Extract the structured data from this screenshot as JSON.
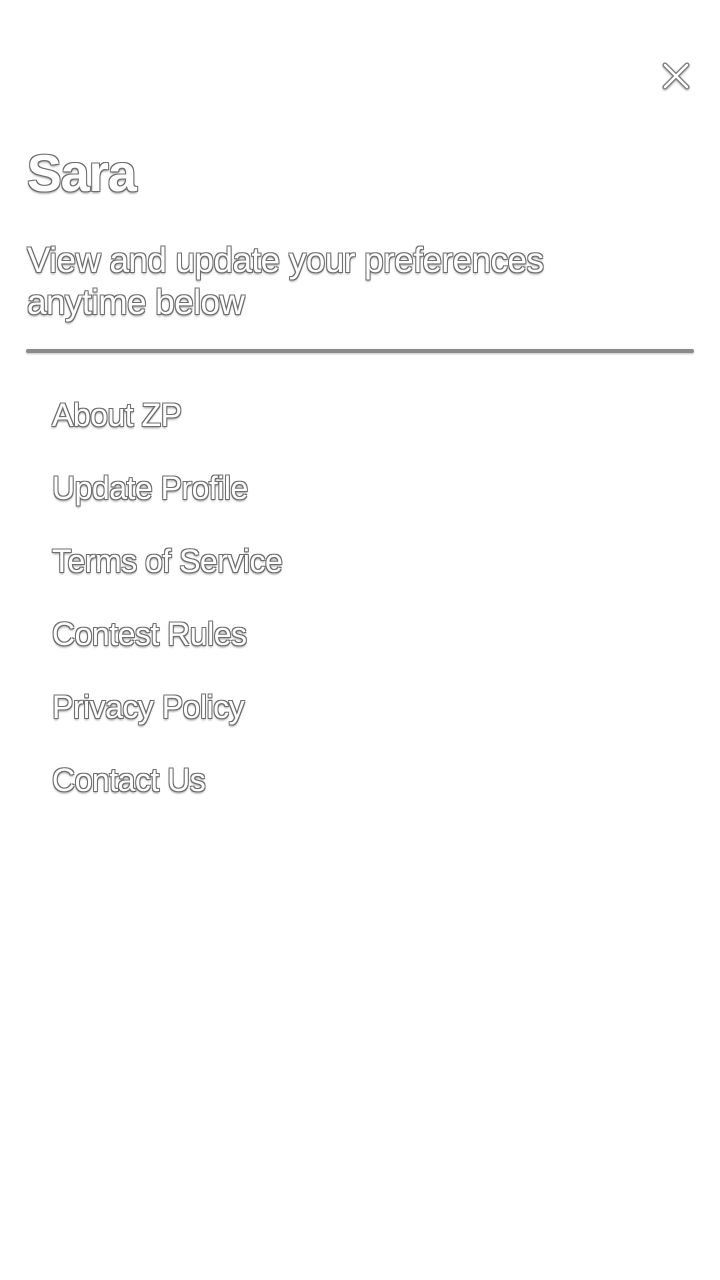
{
  "header": {
    "close_icon": "close-icon"
  },
  "profile": {
    "name": "Sara",
    "subtitle": "View and update your preferences anytime below"
  },
  "menu": {
    "items": [
      {
        "label": "About ZP"
      },
      {
        "label": "Update Profile"
      },
      {
        "label": "Terms of Service"
      },
      {
        "label": "Contest Rules"
      },
      {
        "label": "Privacy Policy"
      },
      {
        "label": "Contact Us"
      }
    ]
  },
  "colors": {
    "background": "#ffffff",
    "text": "#ffffff",
    "outline": "#6d6d6d"
  }
}
